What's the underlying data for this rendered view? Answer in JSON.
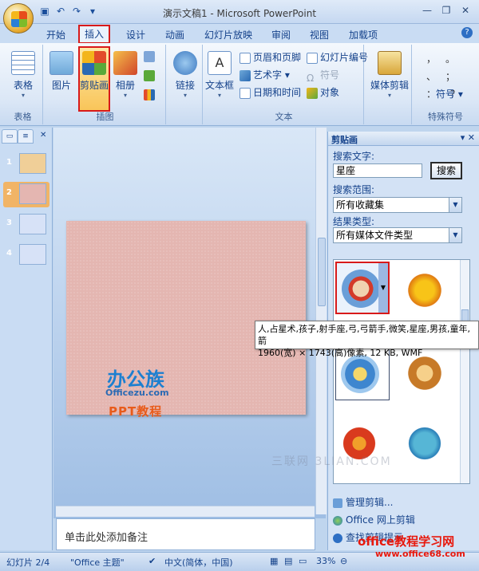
{
  "window": {
    "title": "演示文稿1 - Microsoft PowerPoint",
    "qat": [
      "save-icon",
      "undo-icon",
      "redo-icon",
      "customize-icon"
    ]
  },
  "tabs": [
    "开始",
    "插入",
    "设计",
    "动画",
    "幻灯片放映",
    "审阅",
    "视图",
    "加载项"
  ],
  "active_tab": "插入",
  "ribbon": {
    "groups": {
      "table": {
        "label": "表格",
        "button": "表格"
      },
      "illustrations": {
        "label": "插图",
        "picture": "图片",
        "clipart": "剪贴画",
        "album": "相册"
      },
      "links": {
        "link": "链接"
      },
      "text": {
        "label": "文本",
        "textbox": "文本框",
        "header_footer": "页眉和页脚",
        "wordart": "艺术字",
        "datetime": "日期和时间",
        "slide_number": "幻灯片编号",
        "symbol": "符号",
        "object": "对象"
      },
      "media": {
        "button": "媒体剪辑"
      },
      "special": {
        "label": "特殊符号",
        "symbol": "符号",
        "chars": [
          "，",
          "。",
          "、",
          "；",
          "：",
          "？"
        ]
      }
    }
  },
  "slides": [
    {
      "num": "1",
      "color": "#f0cf98"
    },
    {
      "num": "2",
      "color": "#e4b6b1"
    },
    {
      "num": "3",
      "color": "#d7e2f7"
    },
    {
      "num": "4",
      "color": "#d7e2f7"
    }
  ],
  "slide_brand": {
    "title": "办公族",
    "sub": "Officezu.com",
    "ppt": "PPT教程"
  },
  "notes_placeholder": "单击此处添加备注",
  "clipart_pane": {
    "title": "剪贴画",
    "search_label": "搜索文字:",
    "search_value": "星座",
    "search_button": "搜索",
    "scope_label": "搜索范围:",
    "scope_value": "所有收藏集",
    "type_label": "结果类型:",
    "type_value": "所有媒体文件类型",
    "tooltip_line1": "人,占星术,孩子,射手座,弓,弓箭手,微笑,星座,男孩,童年,箭",
    "tooltip_line2": "1960(宽) × 1743(高)像素, 12 KB, WMF",
    "links": [
      "管理剪辑...",
      "Office 网上剪辑",
      "查找剪辑提示"
    ]
  },
  "status": {
    "slide": "幻灯片 2/4",
    "theme": "\"Office 主题\"",
    "language": "中文(简体，中国)",
    "zoom": "33%"
  },
  "watermarks": {
    "site_cn": "office教程学习网",
    "site_url": "www.office68.com",
    "faint": "三联网 3LIAN.COM"
  }
}
